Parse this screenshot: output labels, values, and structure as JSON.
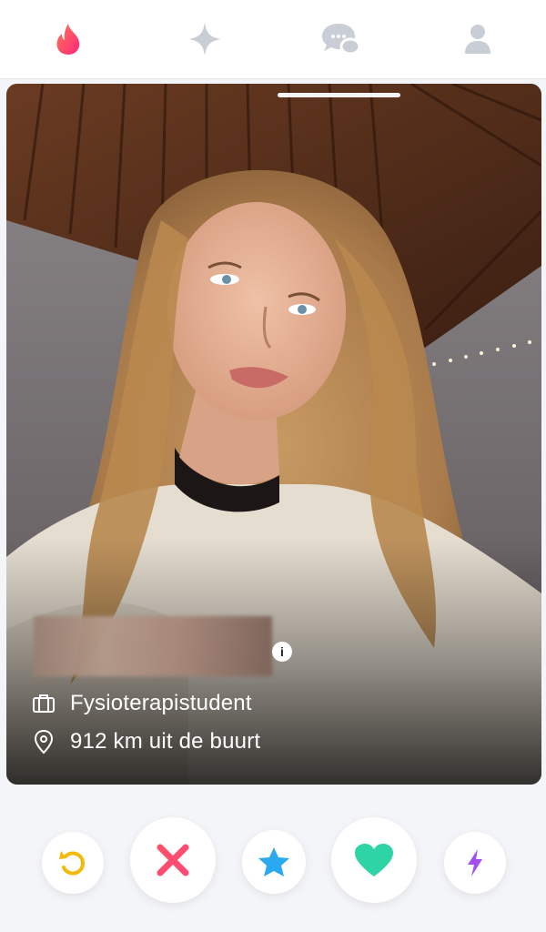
{
  "nav": {
    "items": [
      {
        "icon": "flame-icon",
        "active": true
      },
      {
        "icon": "sparkle-icon",
        "active": false
      },
      {
        "icon": "chat-icon",
        "active": false
      },
      {
        "icon": "profile-icon",
        "active": false
      }
    ],
    "active_color": "#fd4a5a",
    "inactive_color": "#c9ced6"
  },
  "profile": {
    "job": "Fysioterapistudent",
    "distance": "912 km uit de buurt",
    "info_label": "i"
  },
  "actions": [
    {
      "name": "rewind",
      "icon": "rewind-icon",
      "color": "#f5b90a"
    },
    {
      "name": "nope",
      "icon": "close-icon",
      "color": "#fd5068"
    },
    {
      "name": "super-like",
      "icon": "star-icon",
      "color": "#2aa8f0"
    },
    {
      "name": "like",
      "icon": "heart-icon",
      "color": "#2ed3a6"
    },
    {
      "name": "boost",
      "icon": "bolt-icon",
      "color": "#a34ff0"
    }
  ]
}
